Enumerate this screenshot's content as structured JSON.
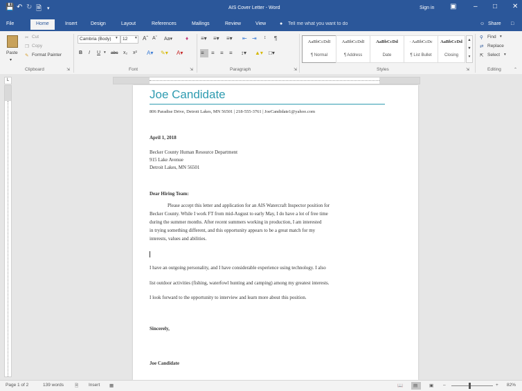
{
  "title_bar": {
    "title": "AIS Cover Letter - Word",
    "sign_in": "Sign in"
  },
  "tabs": [
    "File",
    "Home",
    "Insert",
    "Design",
    "Layout",
    "References",
    "Mailings",
    "Review",
    "View"
  ],
  "tell_me": "Tell me what you want to do",
  "share": "Share",
  "ribbon": {
    "clipboard": {
      "label": "Clipboard",
      "paste": "Paste",
      "cut": "Cut",
      "copy": "Copy",
      "format_painter": "Format Painter"
    },
    "font": {
      "label": "Font",
      "font_name": "Cambria (Body)",
      "font_size": "12"
    },
    "paragraph": {
      "label": "Paragraph"
    },
    "styles": {
      "label": "Styles",
      "items": [
        {
          "preview": "AaBbCcDdI",
          "name": "¶ Normal"
        },
        {
          "preview": "AaBbCcDdI",
          "name": "¶ Address"
        },
        {
          "preview": "AaBbCcDd",
          "name": "Date"
        },
        {
          "preview": "· AaBbCcDc",
          "name": "¶ List Bullet"
        },
        {
          "preview": "AaBbCcDd",
          "name": "Closing"
        }
      ]
    },
    "editing": {
      "label": "Editing",
      "find": "Find",
      "replace": "Replace",
      "select": "Select"
    }
  },
  "document": {
    "name": "Joe Candidate",
    "contact": "806 Paradise Drive, Detroit Lakes, MN 56501 | 218-555-3761 | JoeCandidate1@yahoo.com",
    "date": "April 1, 2018",
    "recipient": [
      "Becker County Human Resource Department",
      "915 Lake Avenue",
      "Detroit Lakes, MN 56501"
    ],
    "salutation": "Dear Hiring Team:",
    "paragraph1": [
      "Please accept this letter and application for an AIS Watercraft Inspector position for",
      "Becker County. While I work FT from mid-August to early May, I do have a lot of free time",
      "during the summer months. After recent summers working in production, I am interested",
      "in trying something different, and this opportunity appears to be a great match for my",
      "interests, values and abilities."
    ],
    "paragraph2": "I have an outgoing personality, and I have considerable experience using technology. I also",
    "paragraph3": "list outdoor activities (fishing, waterfowl hunting and camping) among my greatest interests.",
    "paragraph4": "I look forward to the opportunity to interview and learn more about this position.",
    "closing": "Sincerely,",
    "signature": "Joe Candidate"
  },
  "status_bar": {
    "page": "Page 1 of 2",
    "words": "139 words",
    "mode": "Insert",
    "zoom": "82%"
  },
  "colors": {
    "word_blue": "#2b579a",
    "heading_teal": "#2e9bb0"
  }
}
